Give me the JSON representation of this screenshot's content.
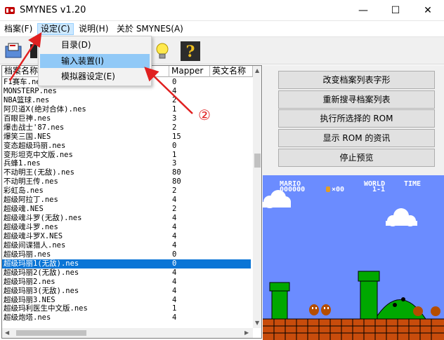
{
  "window": {
    "title": "SMYNES v1.20",
    "minimize": "—",
    "maximize": "☐",
    "close": "✕"
  },
  "menubar": {
    "items": [
      "档案(F)",
      "设定(C)",
      "说明(H)",
      "关於 SMYNES(A)"
    ]
  },
  "dropdown": {
    "items": [
      "目录(D)",
      "输入装置(I)",
      "模拟器设定(E)"
    ],
    "highlighted_index": 1
  },
  "annotation": {
    "number": "②"
  },
  "rom_list": {
    "headers": [
      "档案名称",
      "Mapper",
      "英文名称"
    ],
    "selected_index": 20,
    "rows": [
      {
        "name": "F1赛车.nes",
        "mapper": "0"
      },
      {
        "name": "MONSTERP.nes",
        "mapper": "4"
      },
      {
        "name": "NBA篮球.nes",
        "mapper": "2"
      },
      {
        "name": "阿贝道X(绝对合体).nes",
        "mapper": "1"
      },
      {
        "name": "百眼巨神.nes",
        "mapper": "3"
      },
      {
        "name": "爆击战士'87.nes",
        "mapper": "2"
      },
      {
        "name": "爆笑三国.NES",
        "mapper": "15"
      },
      {
        "name": "变态超级玛丽.nes",
        "mapper": "0"
      },
      {
        "name": "变形坦克中文版.nes",
        "mapper": "1"
      },
      {
        "name": "兵蜂1.nes",
        "mapper": "3"
      },
      {
        "name": "不动明王(无敌).nes",
        "mapper": "80"
      },
      {
        "name": "不动明王传.nes",
        "mapper": "80"
      },
      {
        "name": "彩虹岛.nes",
        "mapper": "2"
      },
      {
        "name": "超级阿拉丁.nes",
        "mapper": "4"
      },
      {
        "name": "超级魂.NES",
        "mapper": "2"
      },
      {
        "name": "超级魂斗罗(无敌).nes",
        "mapper": "4"
      },
      {
        "name": "超级魂斗罗.nes",
        "mapper": "4"
      },
      {
        "name": "超级魂斗罗X.NES",
        "mapper": "4"
      },
      {
        "name": "超级间谍猎人.nes",
        "mapper": "4"
      },
      {
        "name": "超级玛丽.nes",
        "mapper": "0"
      },
      {
        "name": "超级玛丽1(无敌).nes",
        "mapper": "0"
      },
      {
        "name": "超级玛丽2(无敌).nes",
        "mapper": "4"
      },
      {
        "name": "超级玛丽2.nes",
        "mapper": "4"
      },
      {
        "name": "超级玛丽3(无敌).nes",
        "mapper": "4"
      },
      {
        "name": "超级玛丽3.NES",
        "mapper": "4"
      },
      {
        "name": "超级玛利医生中文版.nes",
        "mapper": "1"
      },
      {
        "name": "超级炮塔.nes",
        "mapper": "4"
      }
    ]
  },
  "actions": {
    "buttons": [
      "改变档案列表字形",
      "重新搜寻档案列表",
      "执行所选择的 ROM",
      "显示 ROM 的资讯",
      "停止预览"
    ]
  },
  "game_preview": {
    "hud_mario_label": "MARIO",
    "hud_score": "000000",
    "hud_coins": "×00",
    "hud_world_label": "WORLD",
    "hud_world_value": "1-1",
    "hud_time_label": "TIME"
  },
  "colors": {
    "sky": "#6b8cff",
    "selection": "#0a75d6",
    "annotation_red": "#e02020"
  }
}
